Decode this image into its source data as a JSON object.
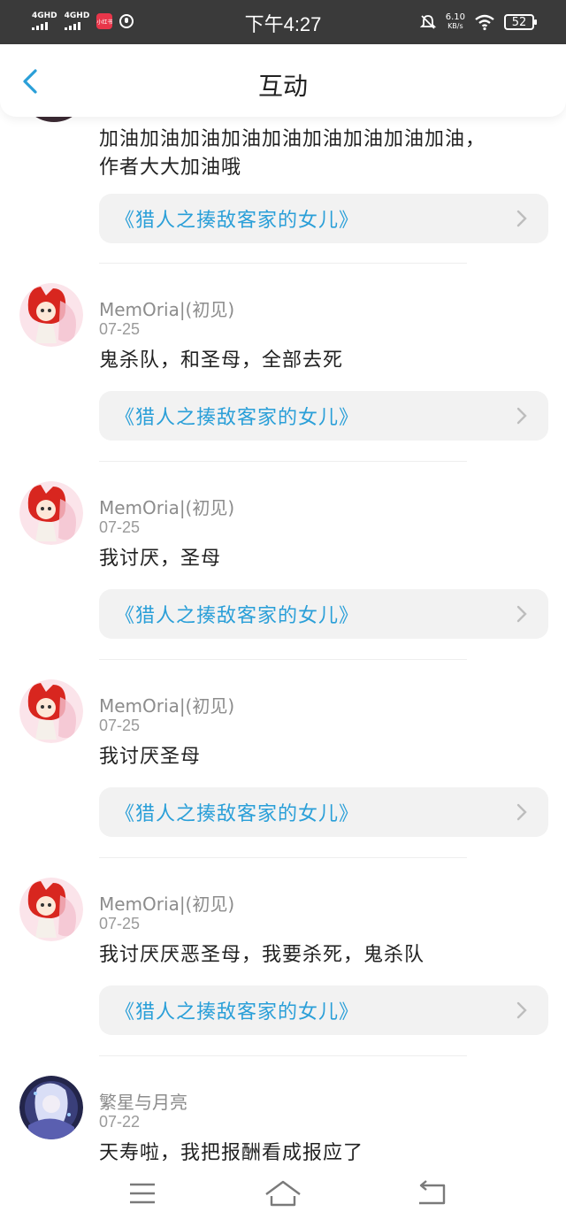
{
  "status_bar": {
    "sig1": "4GHD",
    "sig2": "4GHD",
    "app_badge": "小红书",
    "time": "下午4:27",
    "net_rate": "6.10",
    "net_unit": "KB/s",
    "battery": "52"
  },
  "header": {
    "title": "互动"
  },
  "first": {
    "text_line1": "加油加油加油加油加油加油加油加油加油，",
    "text_line2": "作者大大加油哦",
    "book": "《猎人之揍敌客家的女儿》"
  },
  "items": [
    {
      "user": "MemOria|(初见)",
      "date": "07-25",
      "text": "鬼杀队，和圣母，全部去死",
      "book": "《猎人之揍敌客家的女儿》"
    },
    {
      "user": "MemOria|(初见)",
      "date": "07-25",
      "text": "我讨厌，圣母",
      "book": "《猎人之揍敌客家的女儿》"
    },
    {
      "user": "MemOria|(初见)",
      "date": "07-25",
      "text": "我讨厌圣母",
      "book": "《猎人之揍敌客家的女儿》"
    },
    {
      "user": "MemOria|(初见)",
      "date": "07-25",
      "text": "我讨厌厌恶圣母，我要杀死，鬼杀队",
      "book": "《猎人之揍敌客家的女儿》"
    },
    {
      "user": "繁星与月亮",
      "date": "07-22",
      "text": "天寿啦，我把报酬看成报应了"
    }
  ],
  "icons": {
    "back": "back-chevron-icon",
    "chevron": "chevron-right-icon",
    "menu": "menu-icon",
    "home": "home-icon",
    "return": "return-icon"
  },
  "colors": {
    "accent": "#2a9fd8",
    "status_bar": "#3a3a3a",
    "card_bg": "#f2f2f2"
  }
}
